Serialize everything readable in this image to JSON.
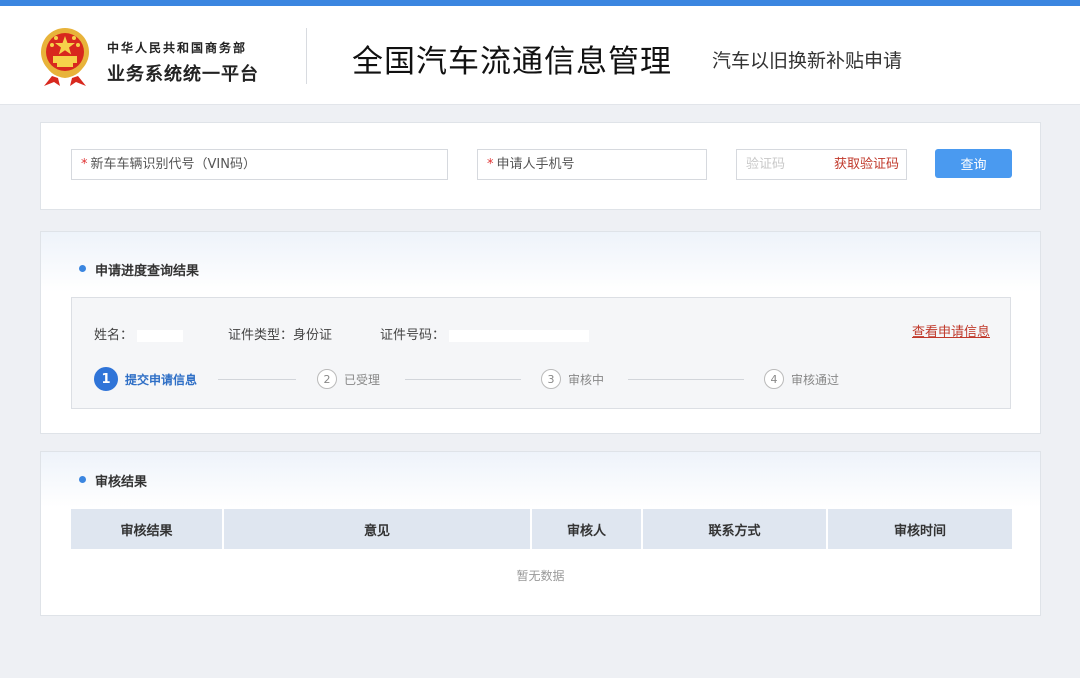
{
  "header": {
    "org_line1": "中华人民共和国商务部",
    "org_line2": "业务系统统一平台",
    "title": "全国汽车流通信息管理",
    "subtitle": "汽车以旧换新补贴申请"
  },
  "search": {
    "vin_label": "新车车辆识别代号（VIN码）",
    "phone_label": "申请人手机号",
    "code_placeholder": "验证码",
    "get_code": "获取验证码",
    "query_button": "查询",
    "required_mark": "*"
  },
  "progress": {
    "section_title": "申请进度查询结果",
    "name_label": "姓名：",
    "id_type": "证件类型：身份证",
    "id_no_label": "证件号码：",
    "view_link": "查看申请信息",
    "steps": [
      {
        "num": "1",
        "label": "提交申请信息"
      },
      {
        "num": "2",
        "label": "已受理"
      },
      {
        "num": "3",
        "label": "审核中"
      },
      {
        "num": "4",
        "label": "审核通过"
      }
    ],
    "current_step": 1
  },
  "result": {
    "section_title": "审核结果",
    "columns": [
      "审核结果",
      "意见",
      "审核人",
      "联系方式",
      "审核时间"
    ],
    "empty_text": "暂无数据"
  },
  "colors": {
    "accent": "#3b86e0",
    "link_red": "#c0392b",
    "header_bg": "#ffffff",
    "page_bg": "#eef0f4"
  },
  "icons": {
    "emblem": "national-emblem-icon"
  }
}
